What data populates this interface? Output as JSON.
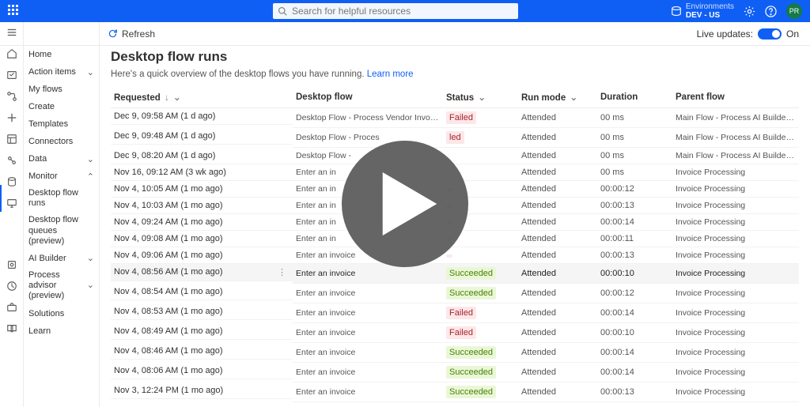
{
  "header": {
    "search_placeholder": "Search for helpful resources",
    "env_label": "Environments",
    "env_value": "DEV - US",
    "avatar_initials": "PR"
  },
  "actionbar": {
    "refresh": "Refresh",
    "live_label": "Live updates:",
    "live_on": "On"
  },
  "sidebar": {
    "home": "Home",
    "action_items": "Action items",
    "my_flows": "My flows",
    "create": "Create",
    "templates": "Templates",
    "connectors": "Connectors",
    "data": "Data",
    "monitor": "Monitor",
    "desktop_flow_runs": "Desktop flow runs",
    "desktop_flow_queues": "Desktop flow queues (preview)",
    "ai_builder": "AI Builder",
    "process_advisor": "Process advisor (preview)",
    "solutions": "Solutions",
    "learn": "Learn"
  },
  "main": {
    "title": "Desktop flow runs",
    "subtitle_text": "Here's a quick overview of the desktop flows you have running. ",
    "subtitle_link": "Learn more",
    "columns": {
      "requested": "Requested",
      "desktop_flow": "Desktop flow",
      "status": "Status",
      "run_mode": "Run mode",
      "duration": "Duration",
      "parent_flow": "Parent flow"
    },
    "rows": [
      {
        "requested": "Dec 9, 09:58 AM (1 d ago)",
        "flow": "Desktop Flow - Process Vendor Invoices",
        "status": "Failed",
        "status_class": "failed",
        "mode": "Attended",
        "duration": "00 ms",
        "parent": "Main Flow - Process AI Builder Docu..."
      },
      {
        "requested": "Dec 9, 09:48 AM (1 d ago)",
        "flow": "Desktop Flow - Proces",
        "status": "led",
        "status_class": "failed",
        "mode": "Attended",
        "duration": "00 ms",
        "parent": "Main Flow - Process AI Builder Docu..."
      },
      {
        "requested": "Dec 9, 08:20 AM (1 d ago)",
        "flow": "Desktop Flow -",
        "status": "",
        "status_class": "",
        "mode": "Attended",
        "duration": "00 ms",
        "parent": "Main Flow - Process AI Builder Docu..."
      },
      {
        "requested": "Nov 16, 09:12 AM (3 wk ago)",
        "flow": "Enter an in",
        "status": "",
        "status_class": "",
        "mode": "Attended",
        "duration": "00 ms",
        "parent": "Invoice Processing"
      },
      {
        "requested": "Nov 4, 10:05 AM (1 mo ago)",
        "flow": "Enter an in",
        "status": "",
        "status_class": "succeeded",
        "mode": "Attended",
        "duration": "00:00:12",
        "parent": "Invoice Processing"
      },
      {
        "requested": "Nov 4, 10:03 AM (1 mo ago)",
        "flow": "Enter an in",
        "status": "",
        "status_class": "succeeded",
        "mode": "Attended",
        "duration": "00:00:13",
        "parent": "Invoice Processing"
      },
      {
        "requested": "Nov 4, 09:24 AM (1 mo ago)",
        "flow": "Enter an in",
        "status": "",
        "status_class": "succeeded",
        "mode": "Attended",
        "duration": "00:00:14",
        "parent": "Invoice Processing"
      },
      {
        "requested": "Nov 4, 09:08 AM (1 mo ago)",
        "flow": "Enter an in",
        "status": "",
        "status_class": "failed",
        "mode": "Attended",
        "duration": "00:00:11",
        "parent": "Invoice Processing"
      },
      {
        "requested": "Nov 4, 09:06 AM (1 mo ago)",
        "flow": "Enter an invoice",
        "status": "",
        "status_class": "failed",
        "mode": "Attended",
        "duration": "00:00:13",
        "parent": "Invoice Processing"
      },
      {
        "requested": "Nov 4, 08:56 AM (1 mo ago)",
        "flow": "Enter an invoice",
        "status": "Succeeded",
        "status_class": "succeeded",
        "mode": "Attended",
        "duration": "00:00:10",
        "parent": "Invoice Processing",
        "hover": true
      },
      {
        "requested": "Nov 4, 08:54 AM (1 mo ago)",
        "flow": "Enter an invoice",
        "status": "Succeeded",
        "status_class": "succeeded",
        "mode": "Attended",
        "duration": "00:00:12",
        "parent": "Invoice Processing"
      },
      {
        "requested": "Nov 4, 08:53 AM (1 mo ago)",
        "flow": "Enter an invoice",
        "status": "Failed",
        "status_class": "failed",
        "mode": "Attended",
        "duration": "00:00:14",
        "parent": "Invoice Processing"
      },
      {
        "requested": "Nov 4, 08:49 AM (1 mo ago)",
        "flow": "Enter an invoice",
        "status": "Failed",
        "status_class": "failed",
        "mode": "Attended",
        "duration": "00:00:10",
        "parent": "Invoice Processing"
      },
      {
        "requested": "Nov 4, 08:46 AM (1 mo ago)",
        "flow": "Enter an invoice",
        "status": "Succeeded",
        "status_class": "succeeded",
        "mode": "Attended",
        "duration": "00:00:14",
        "parent": "Invoice Processing"
      },
      {
        "requested": "Nov 4, 08:06 AM (1 mo ago)",
        "flow": "Enter an invoice",
        "status": "Succeeded",
        "status_class": "succeeded",
        "mode": "Attended",
        "duration": "00:00:14",
        "parent": "Invoice Processing"
      },
      {
        "requested": "Nov 3, 12:24 PM (1 mo ago)",
        "flow": "Enter an invoice",
        "status": "Succeeded",
        "status_class": "succeeded",
        "mode": "Attended",
        "duration": "00:00:13",
        "parent": "Invoice Processing"
      }
    ]
  }
}
